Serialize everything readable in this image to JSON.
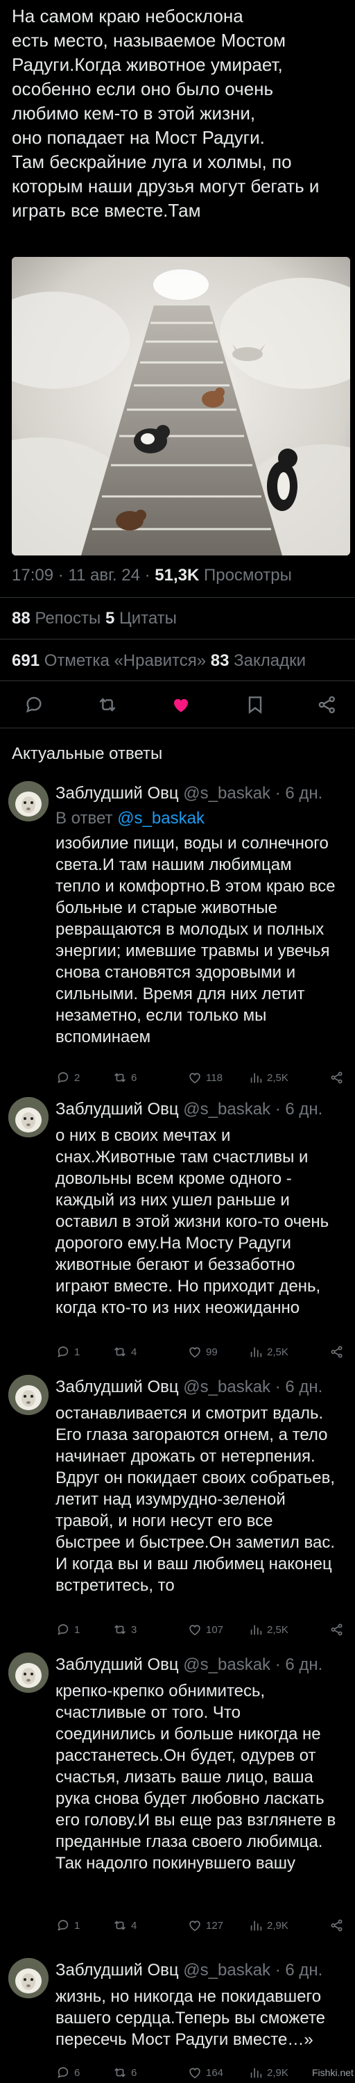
{
  "post": {
    "text": "На самом краю небосклона\nесть место, называемое Мостом\nРадуги.Когда животное умирает,\nособенно если оно было очень\nлюбимо кем-то в этой жизни,\nоно попадает на Мост Радуги.\nТам бескрайние луга и холмы, по\nкоторым наши друзья могут бегать и\nиграть все вместе.Там",
    "time": "17:09 · 11 авг. 24 · ",
    "views_count": "51,3K",
    "views_label": " Просмотры",
    "reposts_count": "88",
    "reposts_label": " Репосты  ",
    "quotes_count": "5",
    "quotes_label": " Цитаты",
    "likes_count": "691",
    "likes_label": " Отметка «Нравится»  ",
    "bookmarks_count": "83",
    "bookmarks_label": " Закладки"
  },
  "colors": {
    "like_active": "#f91880",
    "link": "#1d9bf0",
    "muted": "#71767b"
  },
  "section_title": "Актуальные ответы",
  "replies": [
    {
      "name": "Заблудший Овц",
      "meta": " @s_baskak · 6 дн.",
      "reply_to_prefix": "В ответ ",
      "reply_to_handle": "@s_baskak",
      "text": "изобилие пищи, воды и солнечного\nсвета.И там нашим любимцам\nтепло и комфортно.В этом краю все\nбольные и старые животные\nревращаются в молодых и полных\nэнергии; имевшие травмы и увечья\nснова становятся здоровыми и\nсильными. Время для них летит\nнезаметно, если только мы\nвспоминаем",
      "replies": "2",
      "reposts": "6",
      "likes": "118",
      "views": "2,5K"
    },
    {
      "name": "Заблудший Овц",
      "meta": " @s_baskak · 6 дн.",
      "text": "о них в своих мечтах и\nснах.Животные там счастливы и\nдовольны всем кроме одного -\nкаждый из них ушел раньше и\nоставил в этой жизни кого-то очень\nдорогого ему.На Мосту Радуги\nживотные бегают и беззаботно\nиграют вместе. Но приходит день,\nкогда кто-то из них неожиданно",
      "replies": "1",
      "reposts": "4",
      "likes": "99",
      "views": "2,5K"
    },
    {
      "name": "Заблудший Овц",
      "meta": " @s_baskak · 6 дн.",
      "text": "останавливается и смотрит вдаль.\nЕго глаза загораются огнем, а тело\nначинает дрожать от нетерпения.\nВдруг он покидает своих собратьев,\nлетит над изумрудно-зеленой\nтравой, и ноги несут его все\nбыстрее и быстрее.Он заметил вас.\nИ когда вы и ваш любимец наконец\nвстретитесь, то",
      "replies": "1",
      "reposts": "3",
      "likes": "107",
      "views": "2,5K"
    },
    {
      "name": "Заблудший Овц",
      "meta": " @s_baskak · 6 дн.",
      "text": "крепко-крепко обнимитесь,\nсчастливые от того. Что\nсоединились и больше никогда не\nрасстанетесь.Он будет, одурев от\nсчастья, лизать ваше лицо, ваша\nрука снова будет любовно ласкать\nего голову.И вы еще раз взглянете в\nпреданные глаза своего любимца.\nТак надолго покинувшего вашу",
      "replies": "1",
      "reposts": "4",
      "likes": "127",
      "views": "2,9K"
    },
    {
      "name": "Заблудший Овц",
      "meta": " @s_baskak · 6 дн.",
      "text": "жизнь, но никогда не покидавшего\nвашего сердца.Теперь вы сможете\nпересечь Мост Радуги вместе…»",
      "replies": "6",
      "reposts": "6",
      "likes": "164",
      "views": "2,9K"
    }
  ],
  "watermark": "Fishki.net"
}
